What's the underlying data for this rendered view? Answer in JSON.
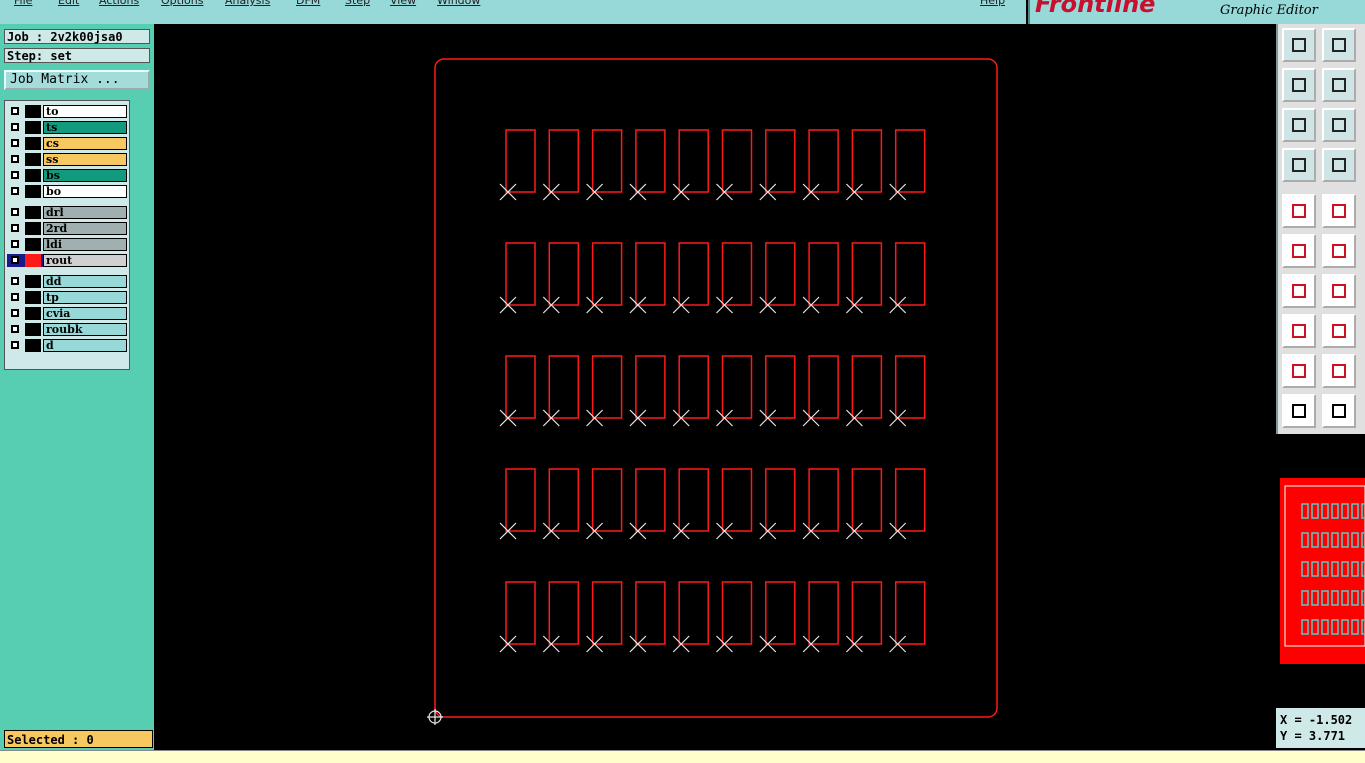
{
  "menu": [
    "File",
    "Edit",
    "Actions",
    "Options",
    "Analysis",
    "DFM",
    "Step",
    "View",
    "Window",
    "Help"
  ],
  "brand": {
    "logo": "Frontline",
    "subtitle": "Graphic Editor"
  },
  "job": {
    "job_line": "Job : 2v2k00jsa0",
    "step_line": "Step: set",
    "matrix_label": "Job Matrix ..."
  },
  "layers": [
    {
      "name": "to",
      "color": "#ffffff"
    },
    {
      "name": "ts",
      "color": "#119a7e"
    },
    {
      "name": "cs",
      "color": "#f8c860"
    },
    {
      "name": "ss",
      "color": "#f8c860"
    },
    {
      "name": "bs",
      "color": "#119a7e"
    },
    {
      "name": "bo",
      "color": "#ffffff"
    },
    {
      "name": "drl",
      "color": "#a0b0b0"
    },
    {
      "name": "2rd",
      "color": "#a0b0b0"
    },
    {
      "name": "ldi",
      "color": "#a0b0b0"
    },
    {
      "name": "rout",
      "color": "#d0d0d0",
      "active": true
    },
    {
      "name": "dd",
      "color": "#97d8d8"
    },
    {
      "name": "tp",
      "color": "#97d8d8"
    },
    {
      "name": "cvia",
      "color": "#97d8d8"
    },
    {
      "name": "roubk",
      "color": "#97d8d8"
    },
    {
      "name": "d",
      "color": "#97d8d8"
    }
  ],
  "status": {
    "selected": "Selected : 0"
  },
  "coords": {
    "x": "X = -1.502",
    "y": "Y = 3.771"
  },
  "drawing": {
    "rows": 5,
    "cols": 10,
    "line_color": "#ff1a1a",
    "marker_color": "#e8e8e8"
  },
  "colors": {
    "panel": "#57cdb2",
    "menubar": "#97d8d8",
    "status_bg": "#f8c860"
  }
}
